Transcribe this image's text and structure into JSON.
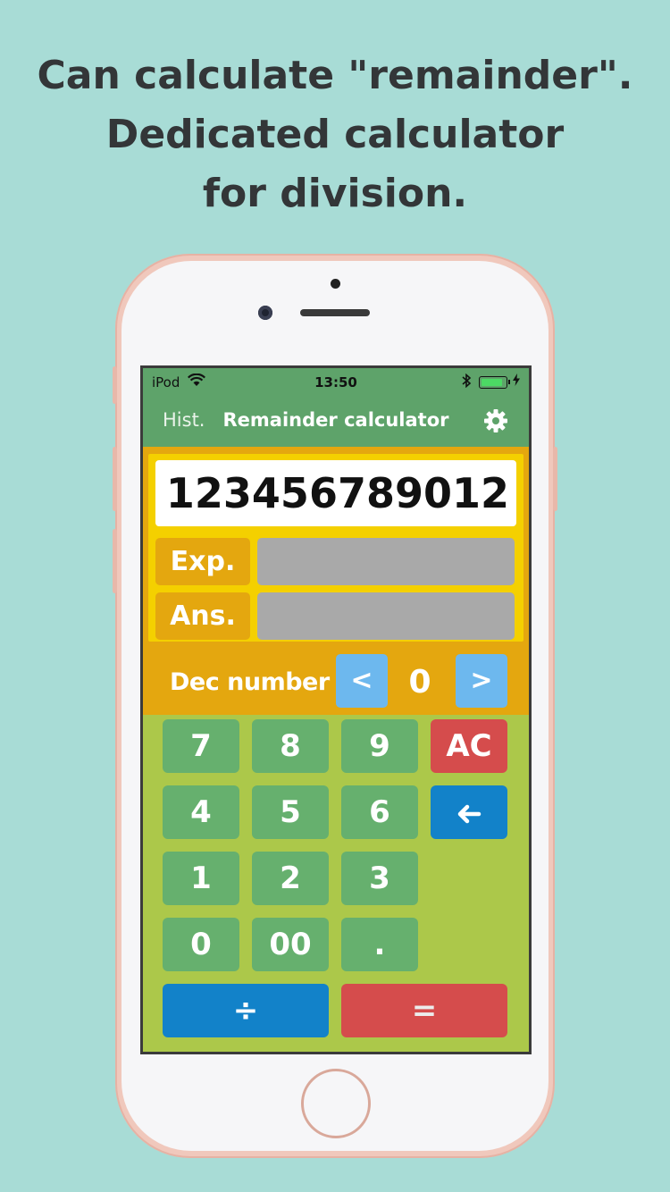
{
  "headline": {
    "line1": "Can calculate \"remainder\".",
    "line2": "Dedicated calculator",
    "line3": "for division."
  },
  "status_bar": {
    "carrier": "iPod",
    "time": "13:50",
    "battery_level": 0.9
  },
  "nav": {
    "history_label": "Hist.",
    "title": "Remainder calculator",
    "settings_icon": "gear-icon"
  },
  "display": {
    "main_value": "123456789012",
    "expression_label": "Exp.",
    "expression_value": "",
    "answer_label": "Ans.",
    "answer_value": ""
  },
  "decimal": {
    "label": "Dec number",
    "decrease_label": "<",
    "increase_label": ">",
    "value": "0"
  },
  "keypad": {
    "k7": "7",
    "k8": "8",
    "k9": "9",
    "ac": "AC",
    "k4": "4",
    "k5": "5",
    "k6": "6",
    "back_icon": "arrow-left-icon",
    "k1": "1",
    "k2": "2",
    "k3": "3",
    "k0": "0",
    "k00": "00",
    "dot": ".",
    "divide": "÷",
    "equals": "="
  },
  "colors": {
    "background": "#a8dcd6",
    "nav_green": "#5ea36a",
    "display_orange": "#e4a70f",
    "display_yellow": "#f4d000",
    "keypad_green": "#acc84a",
    "key_green": "#66b06e",
    "key_red": "#d54c4c",
    "key_blue": "#1282c9",
    "dec_blue": "#6db8ee"
  }
}
